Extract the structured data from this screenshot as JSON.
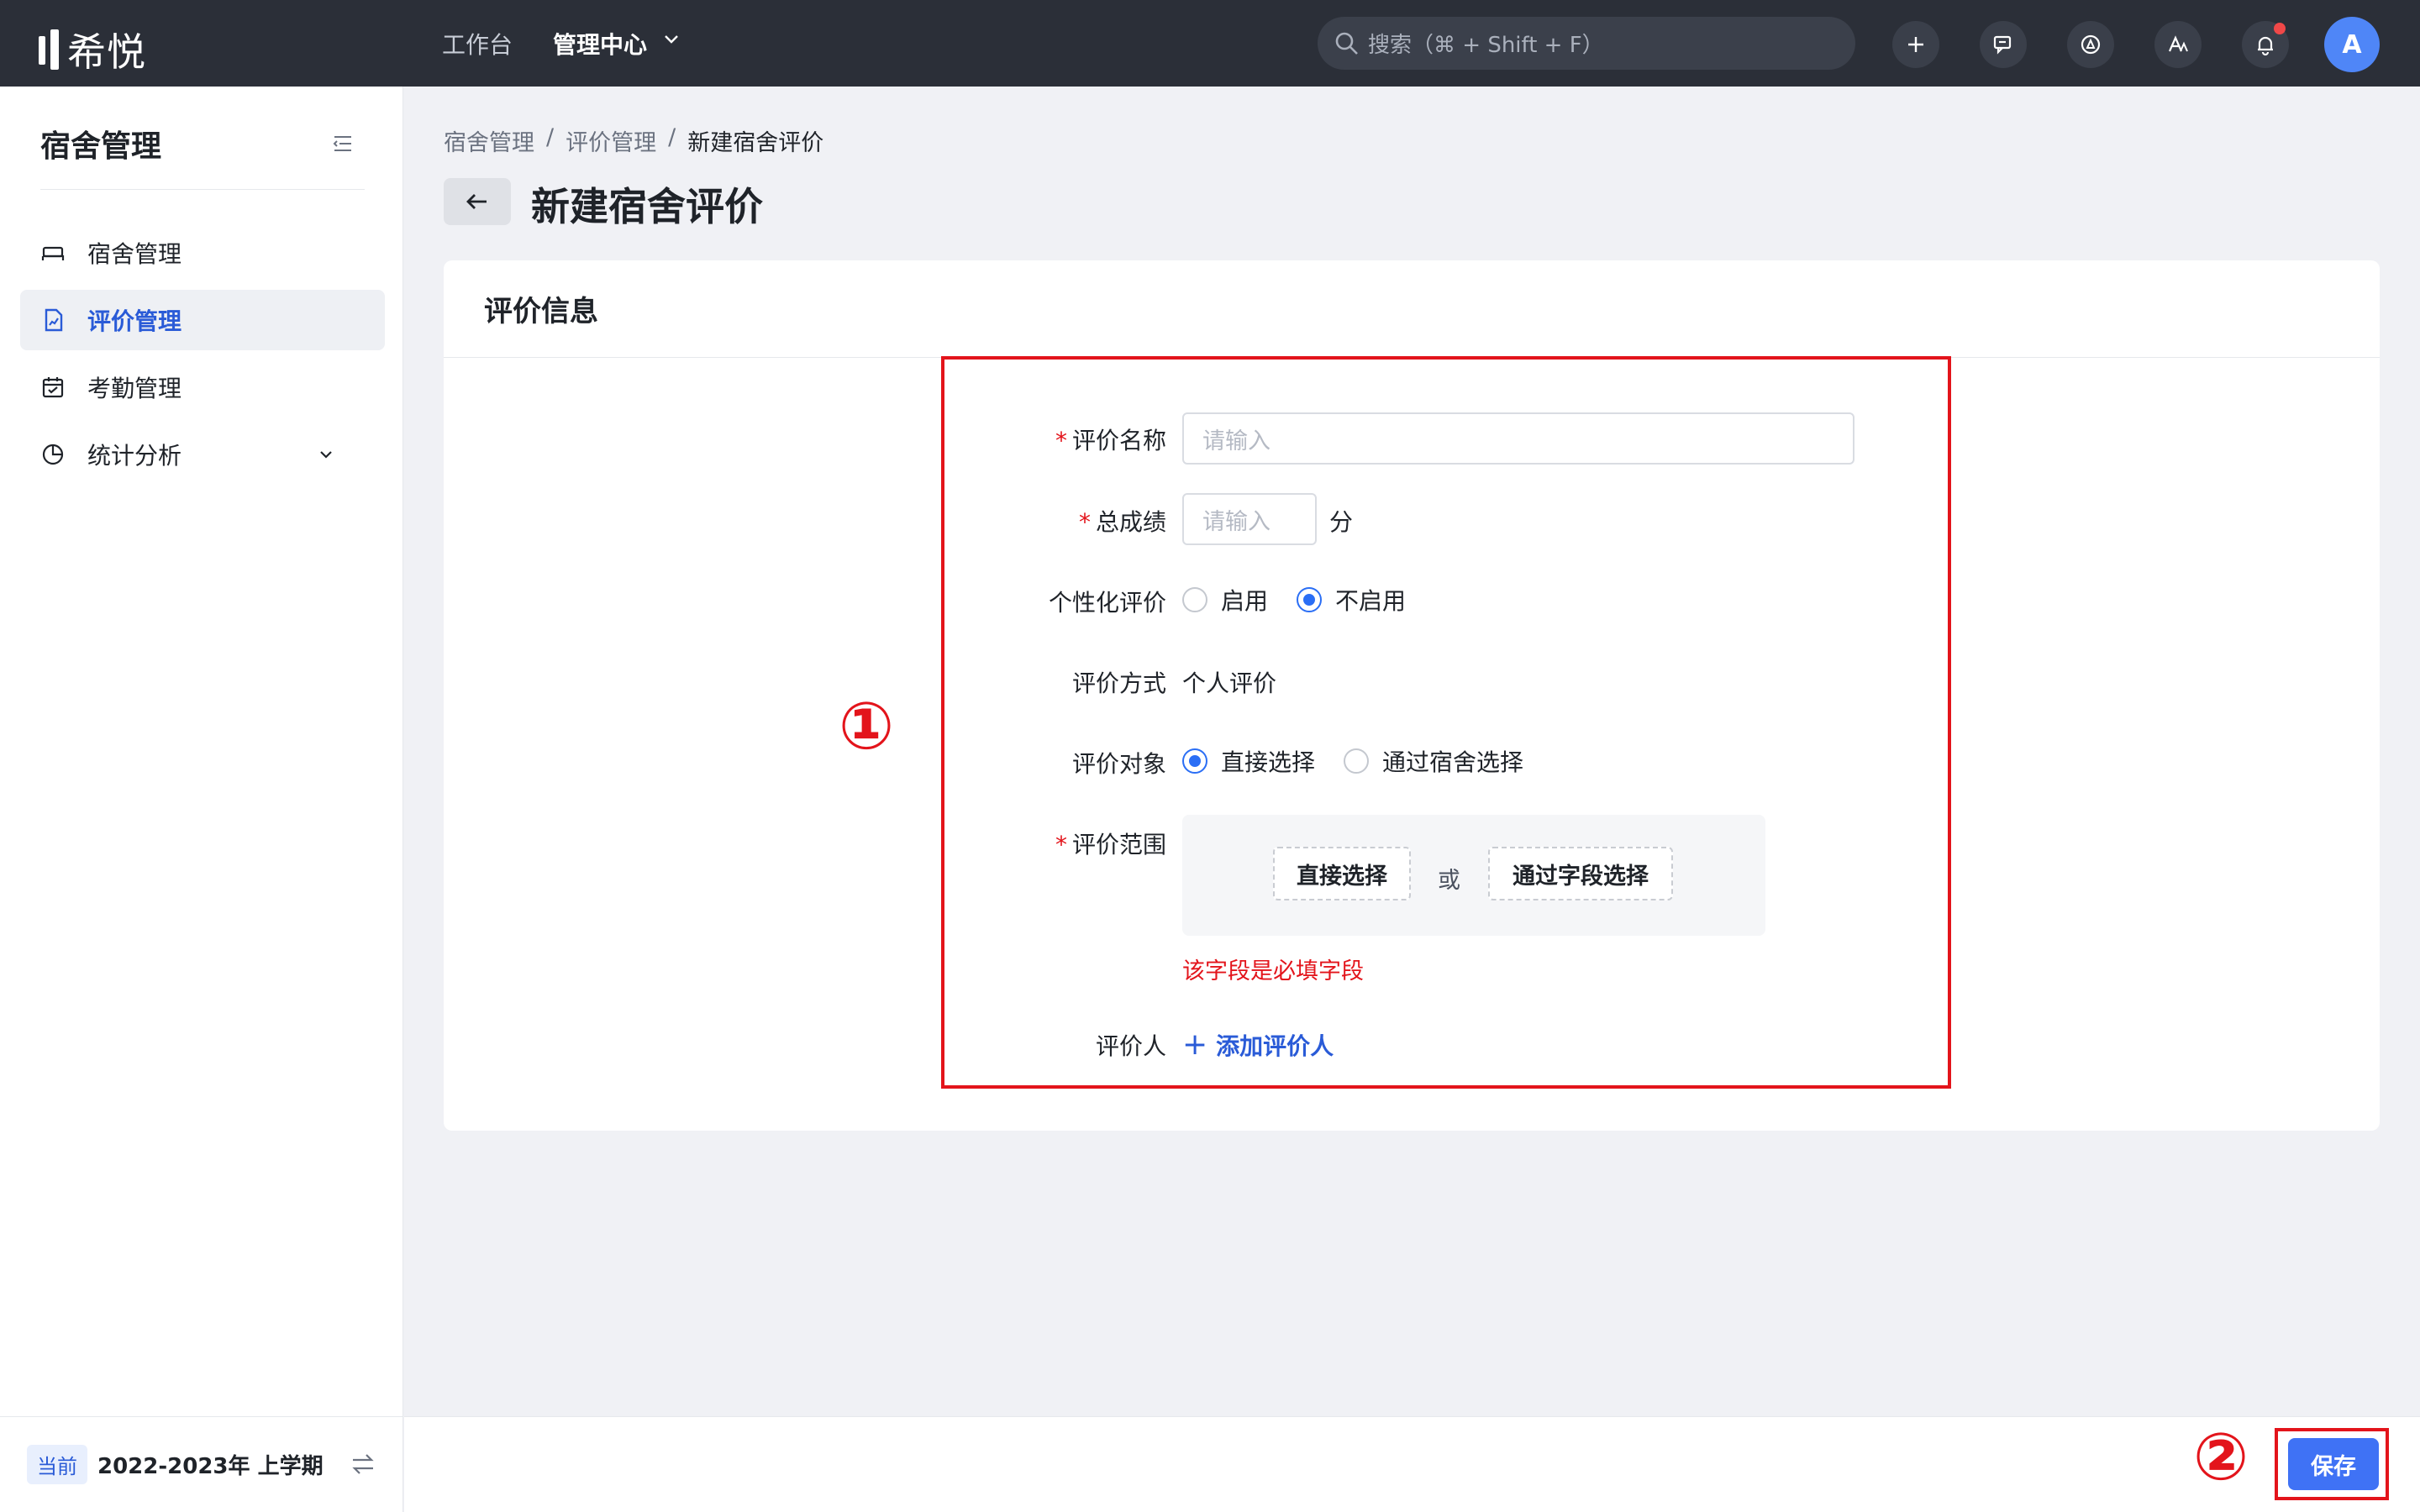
{
  "topbar": {
    "app_name": "希悦",
    "nav": [
      "工作台",
      "管理中心"
    ],
    "search_placeholder": "搜索（⌘ + Shift + F）",
    "avatar_initial": "A"
  },
  "sidebar": {
    "title": "宿舍管理",
    "items": [
      {
        "label": "宿舍管理",
        "icon": "bed-icon"
      },
      {
        "label": "评价管理",
        "icon": "evaluation-doc-icon",
        "active": true
      },
      {
        "label": "考勤管理",
        "icon": "calendar-check-icon"
      },
      {
        "label": "统计分析",
        "icon": "pie-chart-icon",
        "expandable": true
      }
    ],
    "footer": {
      "badge": "当前",
      "term": "2022-2023年 上学期"
    }
  },
  "breadcrumb": [
    "宿舍管理",
    "评价管理",
    "新建宿舍评价"
  ],
  "breadcrumb_sep": "/",
  "page_title": "新建宿舍评价",
  "card": {
    "title": "评价信息"
  },
  "form": {
    "name": {
      "label": "评价名称",
      "placeholder": "请输入"
    },
    "score": {
      "label": "总成绩",
      "placeholder": "请输入",
      "unit": "分"
    },
    "personalized": {
      "label": "个性化评价",
      "options": [
        "启用",
        "不启用"
      ],
      "selected": "不启用"
    },
    "method": {
      "label": "评价方式",
      "value": "个人评价"
    },
    "target": {
      "label": "评价对象",
      "options": [
        "直接选择",
        "通过宿舍选择"
      ],
      "selected": "直接选择"
    },
    "range": {
      "label": "评价范围",
      "direct_btn": "直接选择",
      "or": "或",
      "field_btn": "通过字段选择",
      "error": "该字段是必填字段"
    },
    "evaluator": {
      "label": "评价人",
      "add_label": "添加评价人"
    },
    "required_mark": "*"
  },
  "annotations": [
    "①",
    "②"
  ],
  "actions": {
    "save_label": "保存"
  },
  "colors": {
    "accent": "#3f72f5",
    "topbar": "#2b2f38",
    "error": "#e3141b"
  }
}
